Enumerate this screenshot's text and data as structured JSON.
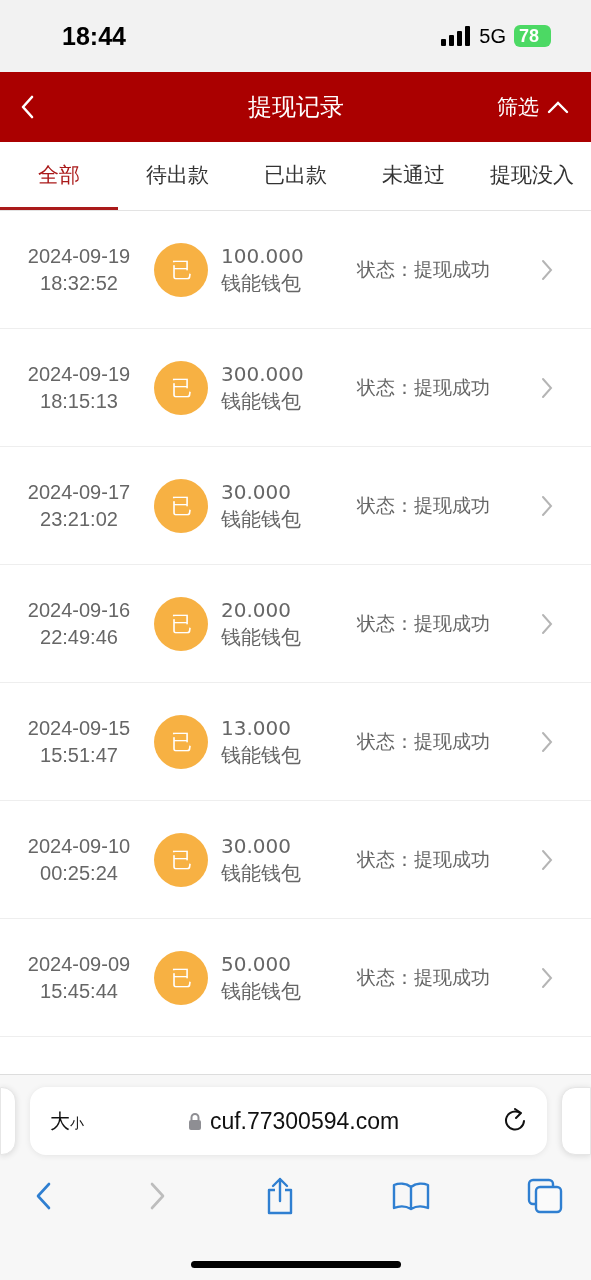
{
  "status_bar": {
    "time": "18:44",
    "network": "5G",
    "battery": "78"
  },
  "header": {
    "title": "提现记录",
    "filter": "筛选"
  },
  "tabs": [
    {
      "label": "全部",
      "selected": true
    },
    {
      "label": "待出款",
      "selected": false
    },
    {
      "label": "已出款",
      "selected": false
    },
    {
      "label": "未通过",
      "selected": false
    },
    {
      "label": "提现没入",
      "selected": false
    }
  ],
  "records": [
    {
      "date": "2024-09-19",
      "time": "18:32:52",
      "badge": "已",
      "amount": "100.000",
      "wallet": "钱能钱包",
      "status": "状态：提现成功"
    },
    {
      "date": "2024-09-19",
      "time": "18:15:13",
      "badge": "已",
      "amount": "300.000",
      "wallet": "钱能钱包",
      "status": "状态：提现成功"
    },
    {
      "date": "2024-09-17",
      "time": "23:21:02",
      "badge": "已",
      "amount": "30.000",
      "wallet": "钱能钱包",
      "status": "状态：提现成功"
    },
    {
      "date": "2024-09-16",
      "time": "22:49:46",
      "badge": "已",
      "amount": "20.000",
      "wallet": "钱能钱包",
      "status": "状态：提现成功"
    },
    {
      "date": "2024-09-15",
      "time": "15:51:47",
      "badge": "已",
      "amount": "13.000",
      "wallet": "钱能钱包",
      "status": "状态：提现成功"
    },
    {
      "date": "2024-09-10",
      "time": "00:25:24",
      "badge": "已",
      "amount": "30.000",
      "wallet": "钱能钱包",
      "status": "状态：提现成功"
    },
    {
      "date": "2024-09-09",
      "time": "15:45:44",
      "badge": "已",
      "amount": "50.000",
      "wallet": "钱能钱包",
      "status": "状态：提现成功"
    }
  ],
  "browser": {
    "text_size": {
      "large": "大",
      "small": "小"
    },
    "url": "cuf.77300594.com"
  }
}
